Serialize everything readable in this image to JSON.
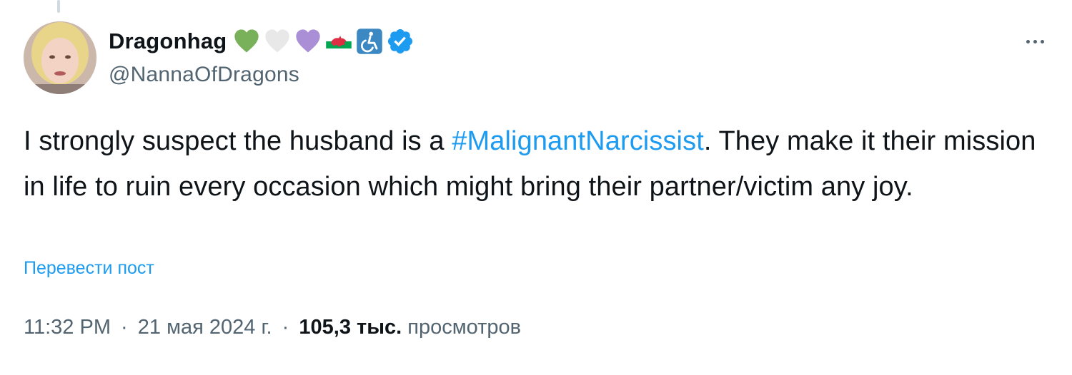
{
  "author": {
    "display_name": "Dragonhag",
    "handle": "@NannaOfDragons",
    "badges": [
      "green-heart-icon",
      "white-heart-icon",
      "purple-heart-icon",
      "wales-flag-icon",
      "wheelchair-symbol-icon",
      "verified-badge-icon"
    ]
  },
  "tweet": {
    "text_before": "I strongly suspect the husband is a ",
    "hashtag": "#MalignantNarcissist",
    "text_after": ". They make it their mission in life to ruin every occasion which might bring their partner/victim any joy."
  },
  "translate_label": "Перевести пост",
  "meta": {
    "time": "11:32 PM",
    "separator": "·",
    "date": "21 мая 2024 г.",
    "views_count": "105,3 тыс.",
    "views_label": "просмотров"
  },
  "colors": {
    "accent": "#1d9bf0",
    "text": "#0f1419",
    "secondary": "#536471",
    "green_heart": "#78b159",
    "purple_heart": "#aa8ed6",
    "wales_red": "#dd2e44",
    "accessibility_blue": "#3b88c3"
  }
}
